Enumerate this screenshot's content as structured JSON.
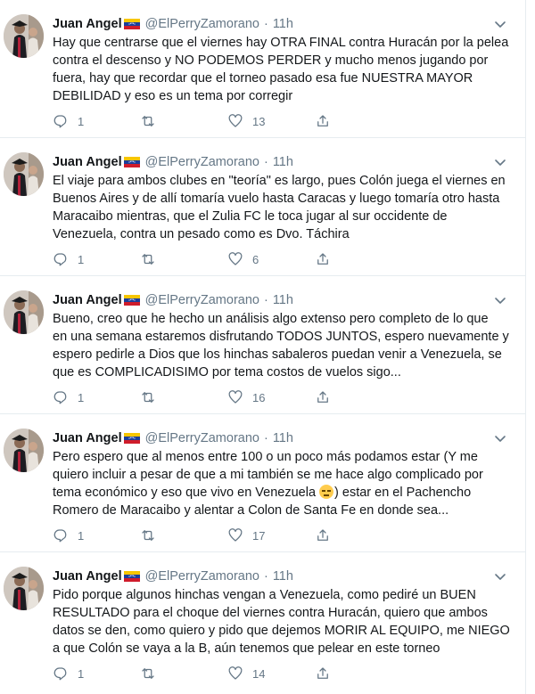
{
  "tweets": [
    {
      "name": "Juan Angel",
      "handle": "@ElPerryZamorano",
      "dot": "·",
      "time": "11h",
      "lines": [
        "Hay que centrarse que el viernes hay OTRA FINAL contra Huracán por la pelea",
        "contra el descenso y NO PODEMOS PERDER y mucho menos jugando por",
        "fuera, hay que recordar que el torneo pasado esa fue NUESTRA MAYOR",
        "DEBILIDAD y eso es un tema por corregir"
      ],
      "replies": "1",
      "retweets": "",
      "likes": "13"
    },
    {
      "name": "Juan Angel",
      "handle": "@ElPerryZamorano",
      "dot": "·",
      "time": "11h",
      "lines": [
        "El viaje para ambos clubes en \"teoría\" es largo, pues Colón juega el viernes en",
        "Buenos Aires y de allí tomaría vuelo hasta Caracas y luego tomaría otro hasta",
        "Maracaibo mientras, que el Zulia FC le toca jugar al sur occidente de",
        "Venezuela, contra un pesado como es Dvo. Táchira"
      ],
      "replies": "1",
      "retweets": "",
      "likes": "6"
    },
    {
      "name": "Juan Angel",
      "handle": "@ElPerryZamorano",
      "dot": "·",
      "time": "11h",
      "lines": [
        "Bueno, creo que he hecho un análisis algo extenso pero completo de lo que",
        "en una semana estaremos disfrutando TODOS JUNTOS, espero nuevamente y",
        "espero pedirle a Dios que los hinchas sabaleros puedan venir a Venezuela, se",
        "que es COMPLICADISIMO por tema costos de vuelos sigo..."
      ],
      "replies": "1",
      "retweets": "",
      "likes": "16"
    },
    {
      "name": "Juan Angel",
      "handle": "@ElPerryZamorano",
      "dot": "·",
      "time": "11h",
      "lines": [
        "Pero espero que al menos entre 100 o un poco más podamos estar (Y me",
        "quiero incluir a pesar de que a mi también se me hace algo complicado por",
        "tema económico y eso que vivo en Venezuela",
        "Romero de Maracaibo y alentar a Colon de Santa Fe en donde sea..."
      ],
      "line3_tail": ") estar en el Pachencho",
      "replies": "1",
      "retweets": "",
      "likes": "17"
    },
    {
      "name": "Juan Angel",
      "handle": "@ElPerryZamorano",
      "dot": "·",
      "time": "11h",
      "lines": [
        "Pido porque algunos hinchas vengan a Venezuela, como pediré un BUEN",
        "RESULTADO para el choque del viernes contra Huracán, quiero que ambos",
        "datos se den, como quiero y pido que dejemos MORIR AL EQUIPO, me NIEGO",
        "a que Colón se vaya a la B, aún tenemos que pelear en este torneo"
      ],
      "replies": "1",
      "retweets": "",
      "likes": "14"
    }
  ],
  "colors": {
    "text": "#14171a",
    "secondary": "#657786",
    "divider": "#e6ecf0"
  },
  "icons": {
    "reply": "reply-icon",
    "retweet": "retweet-icon",
    "like": "heart-icon",
    "share": "share-icon",
    "more": "chevron-down-icon",
    "flag": "venezuela-flag-icon",
    "emoji": "pensive-face-emoji"
  }
}
